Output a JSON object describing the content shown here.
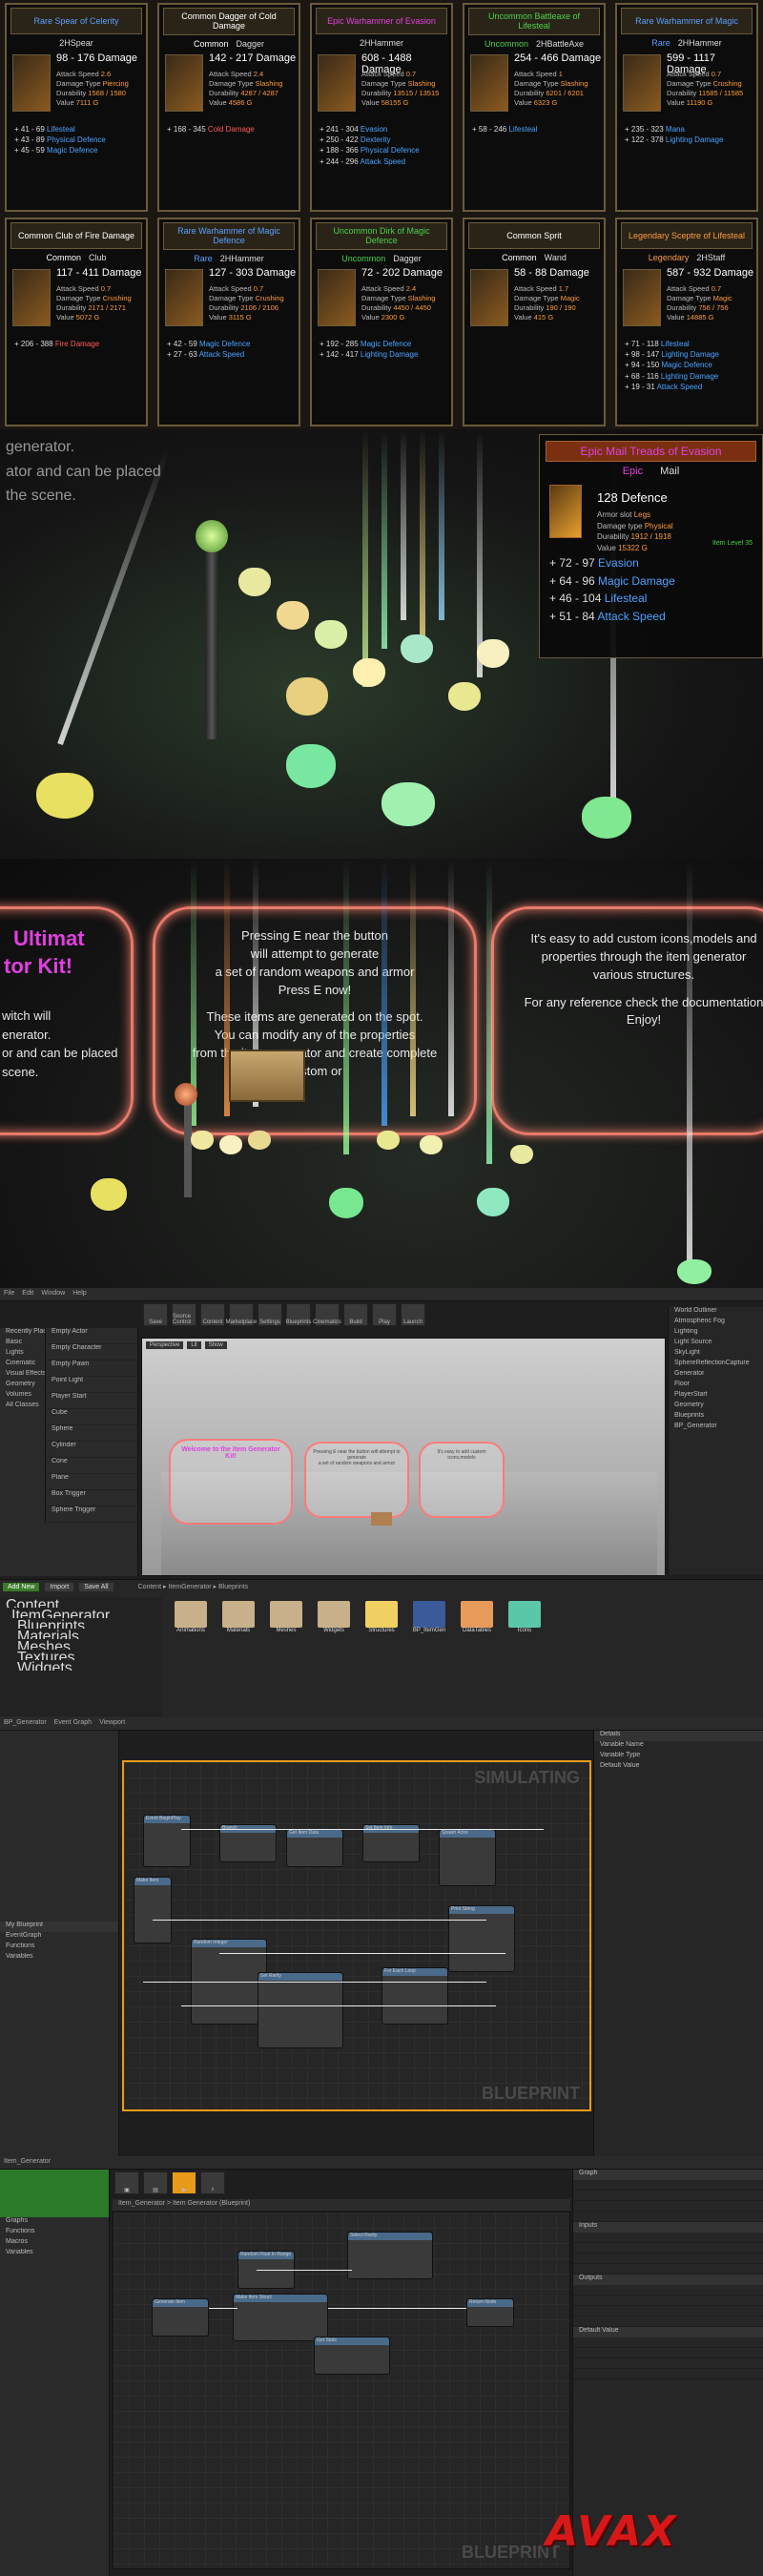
{
  "cards": [
    {
      "title": "Rare Spear of Celerity",
      "rarity": "magic",
      "tier": "",
      "tier_class": "",
      "type": "2HSpear",
      "damage": "98 - 176 Damage",
      "speed": "2.6",
      "dtype": "Piercing",
      "durability": "1568 / 1580",
      "value": "7111 G",
      "bonus": [
        [
          "+ 41 - 69",
          "Lifesteal"
        ],
        [
          "+ 43 - 89",
          "Physical Defence"
        ],
        [
          "+ 45 - 59",
          "Magic Defence"
        ]
      ]
    },
    {
      "title": "Common Dagger of Cold Damage",
      "rarity": "com",
      "tier": "Common",
      "tier_class": "rar-com",
      "type": "Dagger",
      "damage": "142 - 217 Damage",
      "speed": "2.4",
      "dtype": "Slashing",
      "durability": "4287 / 4287",
      "value": "4586 G",
      "bonus": [
        [
          "+ 168 - 345",
          "Cold Damage"
        ]
      ]
    },
    {
      "title": "Epic Warhammer of Evasion",
      "rarity": "epic",
      "tier": "",
      "tier_class": "",
      "type": "2HHammer",
      "damage": "608 - 1488 Damage",
      "speed": "0.7",
      "dtype": "Slashing",
      "durability": "13515 / 13515",
      "value": "58155 G",
      "bonus": [
        [
          "+ 241 - 304",
          "Evasion"
        ],
        [
          "+ 250 - 422",
          "Dexterity"
        ],
        [
          "+ 188 - 366",
          "Physical Defence"
        ],
        [
          "+ 244 - 296",
          "Attack Speed"
        ]
      ]
    },
    {
      "title": "Uncommon Battleaxe of Lifesteal",
      "rarity": "unc",
      "tier": "Uncommon",
      "tier_class": "rar-unc",
      "type": "2HBattleAxe",
      "damage": "254 - 466 Damage",
      "speed": "1",
      "dtype": "Slashing",
      "durability": "6201 / 6201",
      "value": "6323 G",
      "bonus": [
        [
          "+ 58 - 246",
          "Lifesteal"
        ]
      ]
    },
    {
      "title": "Rare Warhammer of Magic",
      "rarity": "magic",
      "tier": "Rare",
      "tier_class": "rar-magic",
      "type": "2HHammer",
      "damage": "599 - 1117 Damage",
      "speed": "0.7",
      "dtype": "Crushing",
      "durability": "11585 / 11585",
      "value": "11190 G",
      "bonus": [
        [
          "+ 235 - 323",
          "Mana"
        ],
        [
          "+ 122 - 378",
          "Lighting Damage"
        ]
      ]
    },
    {
      "title": "Common Club of Fire Damage",
      "rarity": "com",
      "tier": "Common",
      "tier_class": "rar-com",
      "type": "Club",
      "damage": "117 - 411 Damage",
      "speed": "0.7",
      "dtype": "Crushing",
      "durability": "2171 / 2171",
      "value": "5072 G",
      "bonus": [
        [
          "+ 206 - 388",
          "Fire Damage"
        ]
      ]
    },
    {
      "title": "Rare Warhammer of Magic Defence",
      "rarity": "magic",
      "tier": "Rare",
      "tier_class": "rar-magic",
      "type": "2HHammer",
      "damage": "127 - 303 Damage",
      "speed": "0.7",
      "dtype": "Crushing",
      "durability": "2106 / 2106",
      "value": "3115 G",
      "bonus": [
        [
          "+ 42 - 59",
          "Magic Defence"
        ],
        [
          "+ 27 - 63",
          "Attack Speed"
        ]
      ]
    },
    {
      "title": "Uncommon Dirk of Magic Defence",
      "rarity": "unc",
      "tier": "Uncommon",
      "tier_class": "rar-unc",
      "type": "Dagger",
      "damage": "72 - 202 Damage",
      "speed": "2.4",
      "dtype": "Slashing",
      "durability": "4450 / 4450",
      "value": "2300 G",
      "bonus": [
        [
          "+ 192 - 285",
          "Magic Defence"
        ],
        [
          "+ 142 - 417",
          "Lighting Damage"
        ]
      ]
    },
    {
      "title": "Common Sprit",
      "rarity": "com",
      "tier": "Common",
      "tier_class": "rar-com",
      "type": "Wand",
      "damage": "58 - 88 Damage",
      "speed": "1.7",
      "dtype": "Magic",
      "durability": "190 / 190",
      "value": "415 G",
      "bonus": []
    },
    {
      "title": "Legendary Sceptre of Lifesteal",
      "rarity": "leg",
      "tier": "Legendary",
      "tier_class": "rar-leg",
      "type": "2HStaff",
      "damage": "587 - 932 Damage",
      "speed": "0.7",
      "dtype": "Magic",
      "durability": "756 / 756",
      "value": "14885 G",
      "bonus": [
        [
          "+ 71 - 118",
          "Lifesteal"
        ],
        [
          "+ 98 - 147",
          "Lighting Damage"
        ],
        [
          "+ 94 - 150",
          "Magic Defence"
        ],
        [
          "+ 68 - 116",
          "Lighting Damage"
        ],
        [
          "+ 19 - 31",
          "Attack Speed"
        ]
      ]
    }
  ],
  "scene2": {
    "bg_text": [
      "generator.",
      "ator and can be placed",
      "the scene."
    ],
    "tooltip": {
      "title": "Epic Mail Treads of Evasion",
      "rarity": "Epic",
      "type": "Mail",
      "defence": "128 Defence",
      "armor_slot_label": "Armor slot",
      "armor_slot": "Legs",
      "damage_type_label": "Damage type",
      "damage_type": "Physical",
      "durability_label": "Durability",
      "durability": "1912 / 1918",
      "value_label": "Value",
      "value": "15322 G",
      "item_level_label": "Item Level",
      "item_level": "35",
      "bonus": [
        [
          "+ 72 - 97",
          "Evasion"
        ],
        [
          "+ 64 - 96",
          "Magic Damage"
        ],
        [
          "+ 46 - 104",
          "Lifesteal"
        ],
        [
          "+ 51 - 84",
          "Attack Speed"
        ]
      ]
    }
  },
  "scene3": {
    "left_title": [
      "Ultimat",
      "tor Kit!"
    ],
    "left_text": [
      "witch will",
      "enerator.",
      "or and can be placed",
      "scene."
    ],
    "mid_text": [
      "Pressing E near the button",
      "will attempt to generate",
      "a set of random weapons and armor",
      "Press E now!",
      "",
      "These items are generated on the spot.",
      "You can modify any of the properties",
      "from the item generator and create complete custom or"
    ],
    "right_text": [
      "It's easy to add custom icons,models and",
      "properties through the item generator",
      "various structures.",
      "",
      "For any reference check the documentation",
      "Enjoy!"
    ]
  },
  "editor1": {
    "menu": [
      "File",
      "Edit",
      "Window",
      "Help"
    ],
    "toolbar": [
      "Save",
      "Source Control",
      "Content",
      "Marketplace",
      "Settings",
      "Blueprints",
      "Cinematics",
      "Build",
      "Play",
      "Launch"
    ],
    "modes": [
      "Recently Placed",
      "Basic",
      "Lights",
      "Cinematic",
      "Visual Effects",
      "Geometry",
      "Volumes",
      "All Classes"
    ],
    "placeables": [
      "Empty Actor",
      "Empty Character",
      "Empty Pawn",
      "Point Light",
      "Player Start",
      "Cube",
      "Sphere",
      "Cylinder",
      "Cone",
      "Plane",
      "Box Trigger",
      "Sphere Trigger"
    ],
    "viewport_tabs": [
      "Perspective",
      "Lit",
      "Show"
    ],
    "outliner_items": [
      "Atmospheric Fog",
      "Lighting",
      "Light Source",
      "SkyLight",
      "SphereReflectionCapture",
      "Generator",
      "Floor",
      "PlayerStart",
      "Geometry",
      "Blueprints",
      "BP_Generator"
    ],
    "content_toolbar": [
      "Add New",
      "Import",
      "Save All"
    ],
    "breadcrumb": [
      "Content",
      "ItemGenerator",
      "Blueprints"
    ],
    "folders": [
      "Animations",
      "Materials",
      "Meshes",
      "Widgets",
      "Structures",
      "BP_ItemGen",
      "DataTables",
      "Icons"
    ],
    "tree": [
      "Content",
      "ItemGenerator",
      "Blueprints",
      "Materials",
      "Meshes",
      "Textures",
      "Widgets"
    ],
    "screen_text": [
      "Welcome to the Item Generator Kit!",
      "Pressing E near the button will attempt to generate",
      "a set of random weapons and armor",
      "It's easy to add custom icons,models"
    ]
  },
  "editor2": {
    "watermark_top": "SIMULATING",
    "watermark_bottom": "BLUEPRINT",
    "tabs": [
      "BP_Generator",
      "Event Graph",
      "Viewport"
    ],
    "nodes": [
      "Event BeginPlay",
      "Branch",
      "Get Item Data",
      "Set Item Info",
      "Spawn Actor",
      "Make Item",
      "Random Integer",
      "Set Rarity",
      "For Each Loop",
      "Print String"
    ]
  },
  "editor3": {
    "tab": "Item_Generator",
    "breadcrumb": "Item_Generator > Item Generator (Blueprint)",
    "watermark_bottom": "BLUEPRINT",
    "nodes": [
      "Generate Item",
      "Make Item Struct",
      "Return Node",
      "Get Stats",
      "Random Float In Range",
      "Select Rarity"
    ],
    "details_sections": [
      "Graph",
      "Inputs",
      "Outputs",
      "Default Value"
    ]
  },
  "logo": "AVAX"
}
